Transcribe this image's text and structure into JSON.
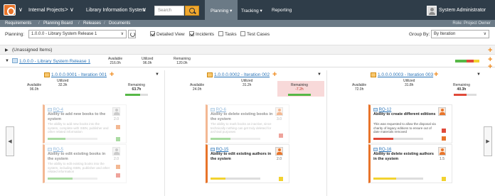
{
  "colors": {
    "topbar": "#2f3d49",
    "accent_orange": "#e8742a",
    "link_blue": "#2a74b8",
    "bar_green": "#57b847",
    "bar_red": "#e04a3a",
    "bar_yellow": "#f2d230",
    "remaining_negative_bg": "#f8d9d9"
  },
  "topbar": {
    "logo_icon": "app-logo-icon",
    "nav": [
      {
        "label": "Internal Projects"
      },
      {
        "label": "Library Information System"
      }
    ],
    "search_placeholder": "Search",
    "menu": [
      {
        "label": "Planning ▾",
        "active": true
      },
      {
        "label": "Tracking ▾",
        "active": false
      },
      {
        "label": "Reporting",
        "active": false
      }
    ],
    "user": "System Administrator"
  },
  "breadcrumbs": {
    "items": [
      "Requirements",
      "Planning Board",
      "Releases",
      "Documents"
    ],
    "role": "Role: Project Owner"
  },
  "filter": {
    "planning_label": "Planning:",
    "planning_value": "1.0.0.0 - Library System Release 1",
    "checkboxes": [
      {
        "label": "Detailed View",
        "checked": true
      },
      {
        "label": "Incidents",
        "checked": true
      },
      {
        "label": "Tasks",
        "checked": false
      },
      {
        "label": "Test Cases",
        "checked": false
      }
    ],
    "group_label": "Group By:",
    "group_value": "By Iteration"
  },
  "unassigned": {
    "label": "(Unassigned Items)"
  },
  "release": {
    "label": "1.0.0.0 - Library System Release 1",
    "available_label": "Available",
    "available_value": "216.0h",
    "utilized_label": "Utilized",
    "utilized_value": "96.0h",
    "remaining_label": "Remaining",
    "remaining_value": "120.0h"
  },
  "iterations": [
    {
      "title": "1.0.0.0.0001 - Iteration 001",
      "available_label": "Available",
      "available": "96.0h",
      "utilized_label": "Utilized",
      "utilized": "32.3h",
      "remaining_label": "Remaining",
      "remaining": "63.7h",
      "remaining_fraction": 0.66,
      "cards": [
        {
          "id": "RQ-4",
          "title": "Ability to add new books to the system",
          "desc": "The ability to add new books into the system, complete with ISBN, publisher and other related information",
          "est": "2.0",
          "progress": 0.35,
          "faded": true
        },
        {
          "id": "RQ-5",
          "title": "Ability to edit existing books in the system",
          "desc": "The ability to edit existing books into the system, including ISBN, publisher and other related information",
          "est": "2.0",
          "progress": 0.5,
          "faded": true
        }
      ]
    },
    {
      "title": "1.0.0.0.0002 - Iteration 002",
      "available_label": "Available",
      "available": "24.0h",
      "utilized_label": "Utilized",
      "utilized": "31.2h",
      "remaining_label": "Remaining",
      "remaining": "-7.2h",
      "remaining_fraction": 0.0,
      "cards": [
        {
          "id": "RQ-6",
          "title": "Ability to delete existing books in the system",
          "desc": "The ability to mark books as inactive, since technically nothing can get truly deleted for archival purposes",
          "est": "3.0",
          "progress": 0.4,
          "faded": true
        },
        {
          "id": "RQ-15",
          "title": "Ability to edit existing authors in the system",
          "desc": "",
          "est": "2.0",
          "progress": 0.3,
          "faded": false
        }
      ]
    },
    {
      "title": "1.0.0.0.0003 - Iteration 003",
      "available_label": "Available",
      "available": "72.0h",
      "utilized_label": "Utilized",
      "utilized": "31.8h",
      "remaining_label": "Remaining",
      "remaining": "40.3h",
      "remaining_fraction": 0.56,
      "cards": [
        {
          "id": "RQ-12",
          "title": "Ability to create different editions",
          "desc": "This was requested to allow the disposal via charity of legacy editions to ensure out of date materials removed",
          "est": "",
          "progress": 0.4,
          "faded": false
        },
        {
          "id": "RQ-16",
          "title": "Ability to delete existing authors in the system",
          "desc": "",
          "est": "1.5",
          "progress": 0.45,
          "faded": false
        }
      ]
    }
  ]
}
